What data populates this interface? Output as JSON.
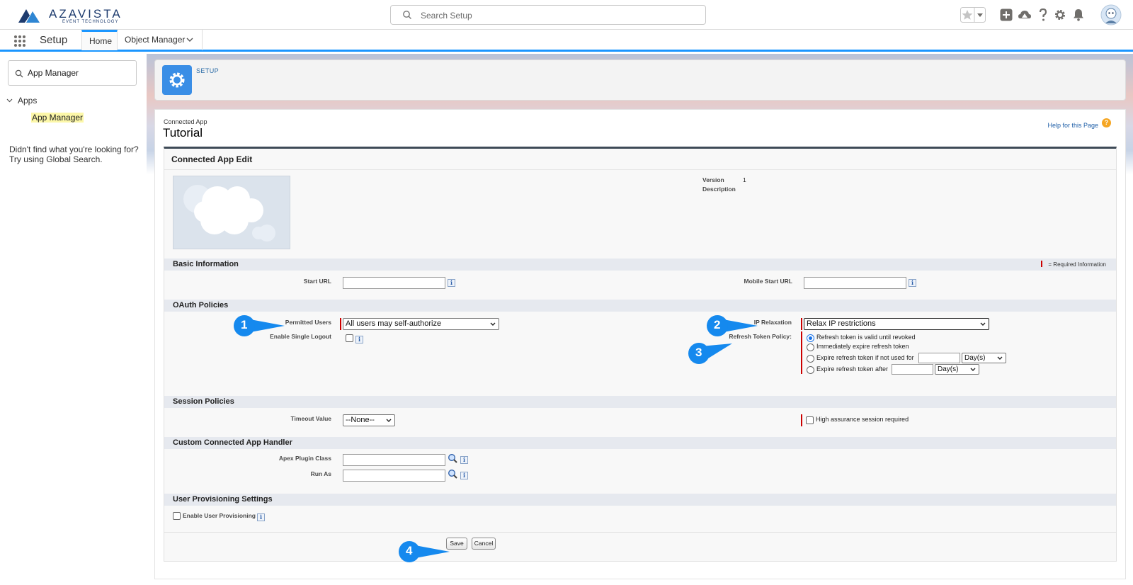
{
  "header": {
    "brand": "AZAVISTA",
    "brand_sub": "EVENT TECHNOLOGY",
    "search_placeholder": "Search Setup"
  },
  "nav": {
    "title": "Setup",
    "tabs": [
      {
        "label": "Home",
        "active": true
      },
      {
        "label": "Object Manager",
        "active": false
      }
    ]
  },
  "sidebar": {
    "search_value": "App Manager",
    "group_label": "Apps",
    "link_label": "App Manager",
    "help_line1": "Didn't find what you're looking for?",
    "help_line2": "Try using Global Search."
  },
  "setup_card": {
    "label": "SETUP"
  },
  "page": {
    "type": "Connected App",
    "name": "Tutorial",
    "help_link": "Help for this Page",
    "help_icon": "?"
  },
  "block": {
    "title": "Connected App Edit",
    "version_label": "Version",
    "version_value": "1",
    "description_label": "Description"
  },
  "basic": {
    "title": "Basic Information",
    "required_legend": "= Required Information",
    "start_url_label": "Start URL",
    "start_url_value": "",
    "mobile_start_url_label": "Mobile Start URL",
    "mobile_start_url_value": ""
  },
  "oauth": {
    "title": "OAuth Policies",
    "permitted_users_label": "Permitted Users",
    "permitted_users_value": "All users may self-authorize",
    "single_logout_label": "Enable Single Logout",
    "ip_relaxation_label": "IP Relaxation",
    "ip_relaxation_value": "Relax IP restrictions",
    "refresh_policy_label": "Refresh Token Policy:",
    "refresh_options": [
      {
        "label": "Refresh token is valid until revoked",
        "selected": true
      },
      {
        "label": "Immediately expire refresh token",
        "selected": false
      },
      {
        "label": "Expire refresh token if not used for",
        "selected": false
      },
      {
        "label": "Expire refresh token after",
        "selected": false
      }
    ],
    "unit_value": "Day(s)"
  },
  "session": {
    "title": "Session Policies",
    "timeout_label": "Timeout Value",
    "timeout_value": "--None--",
    "high_assurance_label": "High assurance session required"
  },
  "handler": {
    "title": "Custom Connected App Handler",
    "apex_label": "Apex Plugin Class",
    "run_as_label": "Run As"
  },
  "provisioning": {
    "title": "User Provisioning Settings",
    "enable_label": "Enable User Provisioning"
  },
  "buttons": {
    "save": "Save",
    "cancel": "Cancel"
  },
  "callouts": [
    "1",
    "2",
    "3",
    "4"
  ],
  "info_glyph": "i",
  "colors": {
    "accent": "#1b96ff",
    "callout": "#1589ee",
    "required": "#cc0000",
    "setup_icon": "#3a8ee6"
  }
}
